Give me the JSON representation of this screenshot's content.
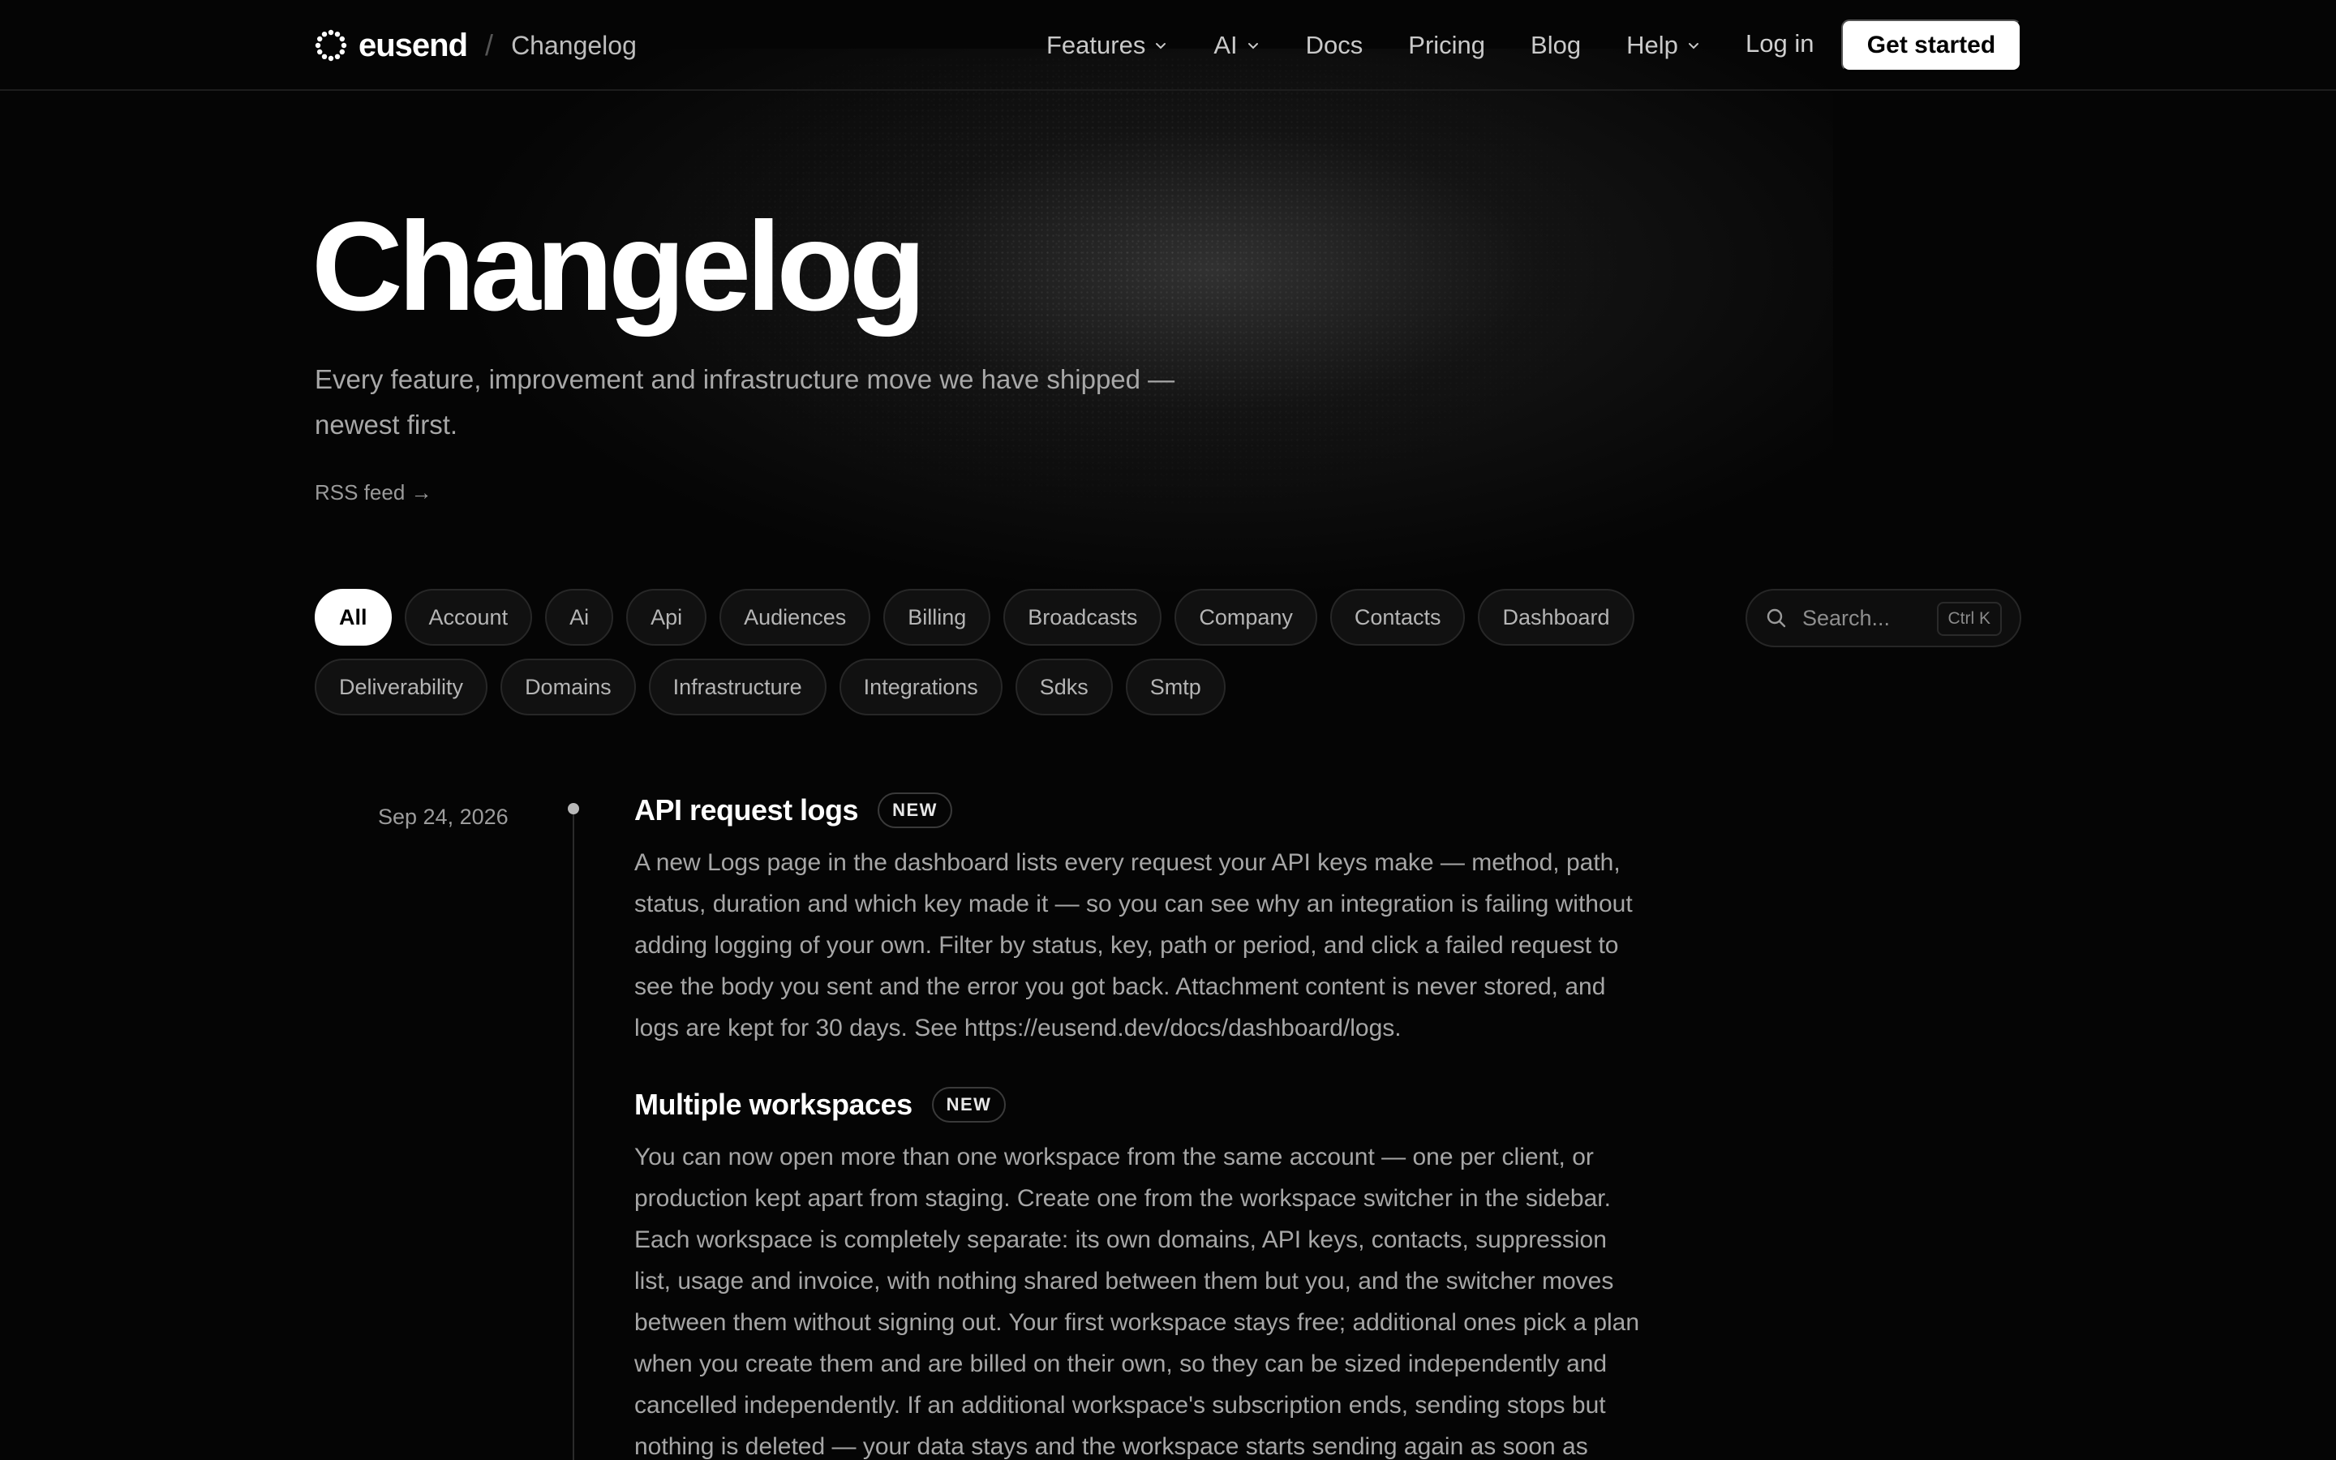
{
  "nav": {
    "brand": "eusend",
    "separator": "/",
    "page": "Changelog",
    "links": [
      {
        "label": "Features",
        "dropdown": true
      },
      {
        "label": "AI",
        "dropdown": true
      },
      {
        "label": "Docs",
        "dropdown": false
      },
      {
        "label": "Pricing",
        "dropdown": false
      },
      {
        "label": "Blog",
        "dropdown": false
      },
      {
        "label": "Help",
        "dropdown": true
      }
    ],
    "login": "Log in",
    "cta": "Get started"
  },
  "hero": {
    "title": "Changelog",
    "subtitle": "Every feature, improvement and infrastructure move we have shipped — newest first.",
    "rss": "RSS feed →"
  },
  "filters": {
    "row1": [
      "All",
      "Account",
      "Ai",
      "Api",
      "Audiences",
      "Billing",
      "Broadcasts",
      "Company",
      "Contacts",
      "Dashboard"
    ],
    "row2": [
      "Deliverability",
      "Domains",
      "Infrastructure",
      "Integrations",
      "Sdks",
      "Smtp"
    ],
    "active": "All"
  },
  "search": {
    "placeholder": "Search...",
    "shortcut": "Ctrl K"
  },
  "timeline": {
    "date": "Sep 24, 2026",
    "entries": [
      {
        "title": "API request logs",
        "badge": "NEW",
        "body": "A new Logs page in the dashboard lists every request your API keys make — method, path, status, duration and which key made it — so you can see why an integration is failing without adding logging of your own. Filter by status, key, path or period, and click a failed request to see the body you sent and the error you got back. Attachment content is never stored, and logs are kept for 30 days. See https://eusend.dev/docs/dashboard/logs."
      },
      {
        "title": "Multiple workspaces",
        "badge": "NEW",
        "body": "You can now open more than one workspace from the same account — one per client, or production kept apart from staging. Create one from the workspace switcher in the sidebar. Each workspace is completely separate: its own domains, API keys, contacts, suppression list, usage and invoice, with nothing shared between them but you, and the switcher moves between them without signing out. Your first workspace stays free; additional ones pick a plan when you create them and are billed on their own, so they can be sized independently and cancelled independently. If an additional workspace's subscription ends, sending stops but nothing is deleted — your data stays and the workspace starts sending again as soon as"
      }
    ]
  },
  "colors": {
    "background": "#050505",
    "text_primary": "#ffffff",
    "text_muted": "#a6a6a6",
    "chip_border": "#272727",
    "accent_button": "#ffffff"
  },
  "icons": {
    "logo": "dotted-circle-logo-icon",
    "chevron": "chevron-down-icon",
    "search": "search-icon"
  }
}
